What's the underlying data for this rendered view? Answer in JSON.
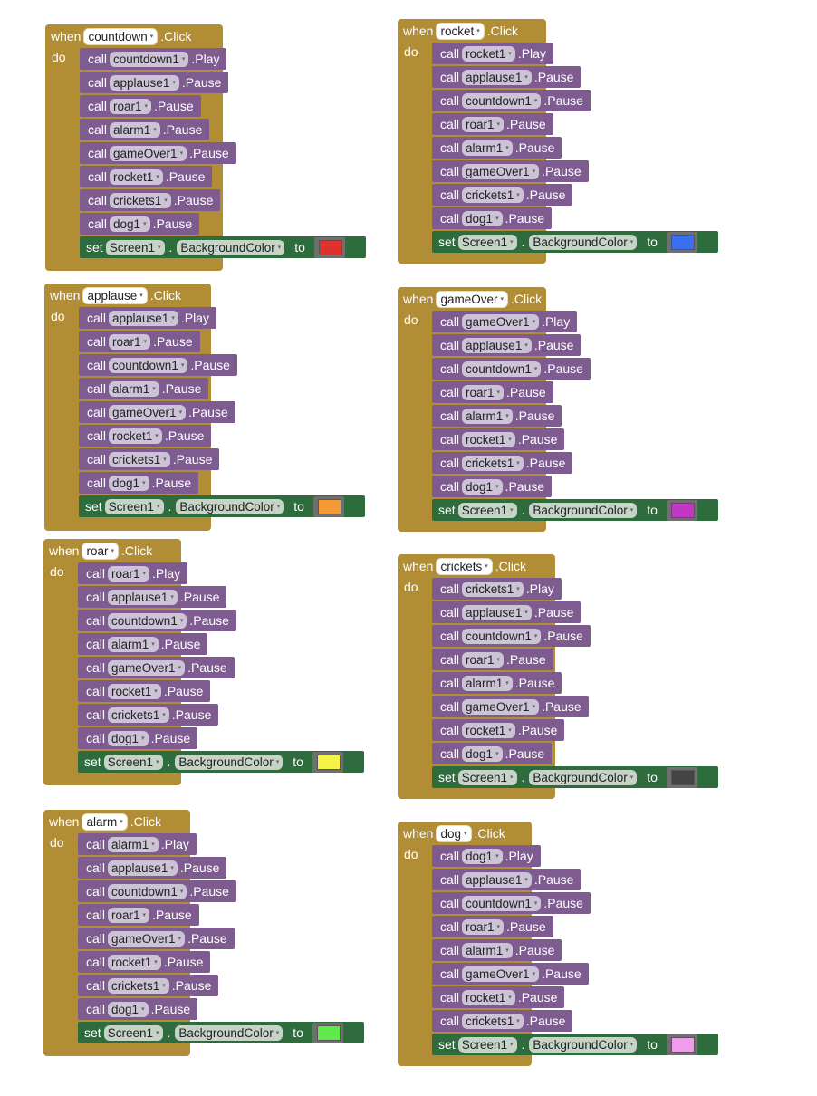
{
  "labels": {
    "when": "when",
    "do": "do",
    "call": "call",
    "set": "set",
    "to": "to",
    "click": ".Click",
    "play": ".Play",
    "pause": ".Pause",
    "dot": "."
  },
  "setter": {
    "component": "Screen1",
    "property": "BackgroundColor"
  },
  "blocks": [
    {
      "event": "countdown",
      "play": "countdown1",
      "pauses": [
        "applause1",
        "roar1",
        "alarm1",
        "gameOver1",
        "rocket1",
        "crickets1",
        "dog1"
      ],
      "color": "#e0322d"
    },
    {
      "event": "rocket",
      "play": "rocket1",
      "pauses": [
        "applause1",
        "countdown1",
        "roar1",
        "alarm1",
        "gameOver1",
        "crickets1",
        "dog1"
      ],
      "color": "#3c6ef0"
    },
    {
      "event": "applause",
      "play": "applause1",
      "pauses": [
        "roar1",
        "countdown1",
        "alarm1",
        "gameOver1",
        "rocket1",
        "crickets1",
        "dog1"
      ],
      "color": "#f29a35"
    },
    {
      "event": "gameOver",
      "play": "gameOver1",
      "pauses": [
        "applause1",
        "countdown1",
        "roar1",
        "alarm1",
        "rocket1",
        "crickets1",
        "dog1"
      ],
      "color": "#c136c6"
    },
    {
      "event": "roar",
      "play": "roar1",
      "pauses": [
        "applause1",
        "countdown1",
        "alarm1",
        "gameOver1",
        "rocket1",
        "crickets1",
        "dog1"
      ],
      "color": "#f5f347"
    },
    {
      "event": "crickets",
      "play": "crickets1",
      "pauses": [
        "applause1",
        "countdown1",
        "roar1",
        "alarm1",
        "gameOver1",
        "rocket1",
        "dog1"
      ],
      "color": "#444444"
    },
    {
      "event": "alarm",
      "play": "alarm1",
      "pauses": [
        "applause1",
        "countdown1",
        "roar1",
        "gameOver1",
        "rocket1",
        "crickets1",
        "dog1"
      ],
      "color": "#5fea4a"
    },
    {
      "event": "dog",
      "play": "dog1",
      "pauses": [
        "applause1",
        "countdown1",
        "roar1",
        "alarm1",
        "gameOver1",
        "rocket1",
        "crickets1"
      ],
      "color": "#f29cec"
    }
  ]
}
